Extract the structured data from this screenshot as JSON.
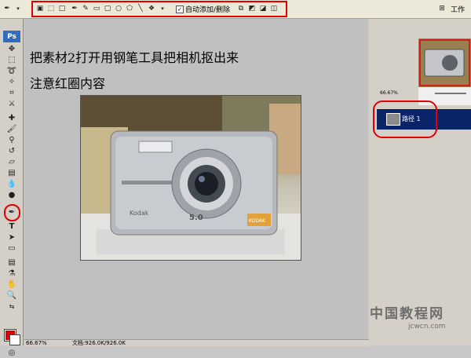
{
  "options_bar": {
    "auto_add_label": "自动添加/删除",
    "auto_add_checked": "✓",
    "right_text": "工作"
  },
  "toolbox": {
    "logo": "Ps",
    "foreground_color": "#e00000",
    "background_color": "#ffffff"
  },
  "canvas": {
    "instruction_1": "把素材2打开用钢笔工具把相机抠出来",
    "instruction_2": "注意红圈内容",
    "camera_brand": "Kodak",
    "camera_mp": "5.0",
    "camera_badge": "KODAK"
  },
  "status_bar": {
    "zoom": "66.67%",
    "doc_info": "文档:926.0K/926.0K"
  },
  "right_panel": {
    "navigator_zoom": "66.67%",
    "path_name": "路径 1"
  },
  "watermark": {
    "site_cn": "中国教程网",
    "site_url": "jcwcn.com"
  },
  "colors": {
    "highlight_red": "#e00000",
    "selection_blue": "#0a246a"
  }
}
